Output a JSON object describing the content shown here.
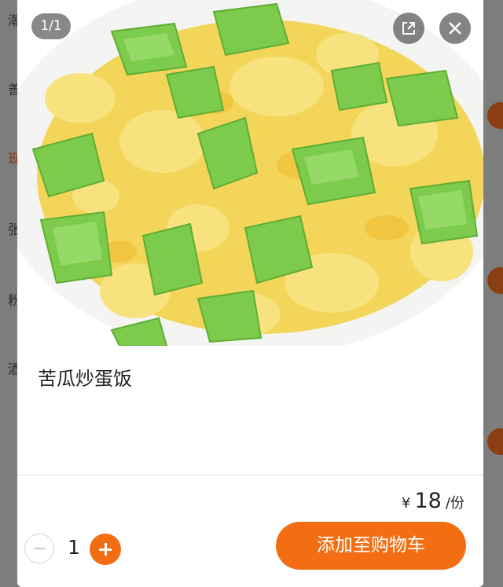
{
  "background": {
    "categories": [
      {
        "label": "潮",
        "active": false
      },
      {
        "label": "善",
        "active": false
      },
      {
        "label": "现",
        "active": true
      },
      {
        "label": "张",
        "active": false
      },
      {
        "label": "粉",
        "active": false
      },
      {
        "label": "酒",
        "active": false
      }
    ]
  },
  "modal": {
    "image_counter": "1/1",
    "share_icon": "share-icon",
    "close_icon": "close-icon",
    "dish_name": "苦瓜炒蛋饭",
    "price": {
      "currency": "¥",
      "amount": "18",
      "unit": "/份"
    },
    "quantity": "1",
    "add_to_cart_label": "添加至购物车",
    "accent_color": "#f36e13"
  }
}
